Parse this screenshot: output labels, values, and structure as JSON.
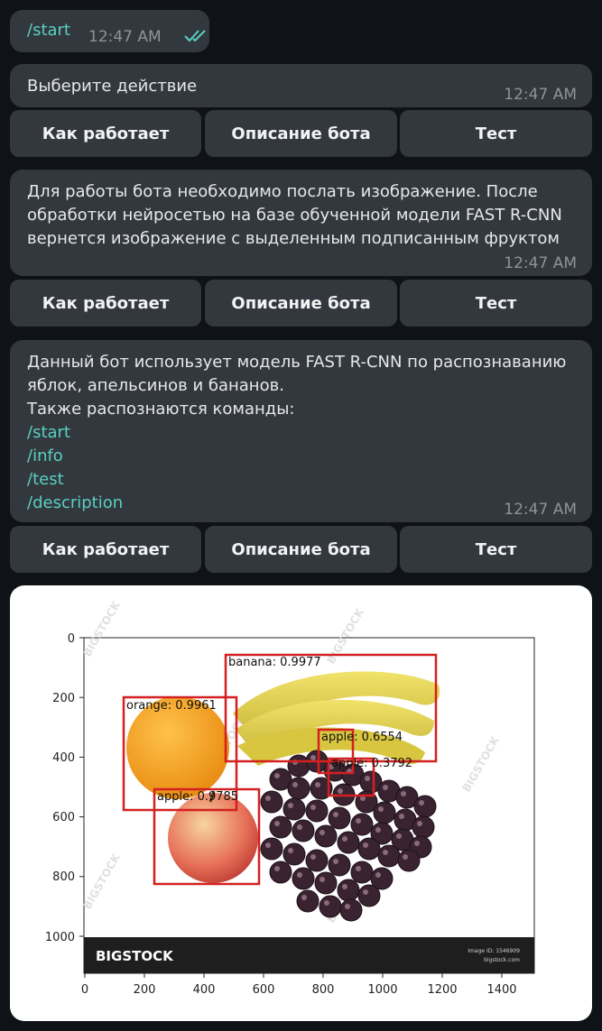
{
  "outgoing": {
    "command": "/start",
    "time": "12:47 AM"
  },
  "messages": [
    {
      "text": "Выберите действие",
      "time": "12:47 AM"
    },
    {
      "lines": [
        "Для работы бота необходимо послать изображение. После",
        "обработки нейросетью на базе обученной модели FAST R-CNN",
        "вернется изображение с выделенным подписанным фруктом"
      ],
      "time": "12:47 AM"
    },
    {
      "lines": [
        "Данный бот использует модель FAST R-CNN по распознаванию",
        "яблок, апельсинов и бананов.",
        "Также распознаются команды:"
      ],
      "commands": [
        "/start",
        "/info",
        "/test",
        "/description"
      ],
      "time": "12:47 AM"
    }
  ],
  "buttons": {
    "how": "Как работает",
    "about": "Описание бота",
    "test": "Тест"
  },
  "photo": {
    "x_ticks": [
      "0",
      "200",
      "400",
      "600",
      "800",
      "1000",
      "1200",
      "1400"
    ],
    "y_ticks": [
      "0",
      "200",
      "400",
      "600",
      "800",
      "1000"
    ],
    "detections": [
      {
        "label": "banana: 0.9977"
      },
      {
        "label": "orange: 0.9961"
      },
      {
        "label": "apple: 0.6554"
      },
      {
        "label": "apple: 0.3792"
      },
      {
        "label": "apple: 0.9785"
      }
    ],
    "watermark": "BIGSTOCK",
    "image_id": "Image ID: 1546909",
    "site": "bigstock.com",
    "colors": {
      "box": "#d42020",
      "orange": "#f5a21a",
      "banana": "#e8d24a",
      "apple": "#e86a55",
      "grape": "#3a2330"
    }
  }
}
